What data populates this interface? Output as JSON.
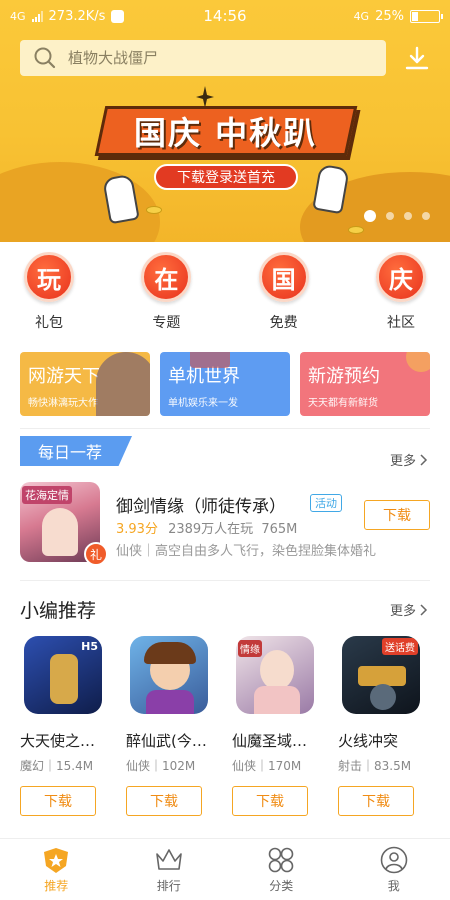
{
  "status": {
    "network": "4G",
    "speed": "273.2K/s",
    "time": "14:56",
    "network_right": "4G",
    "battery": "25%",
    "battery_level": 0.25
  },
  "search": {
    "placeholder": "植物大战僵尸"
  },
  "banner": {
    "title": "国庆 中秋趴",
    "subtitle": "下载登录送首充",
    "slides": 4,
    "active_slide": 0
  },
  "categories": [
    {
      "glyph": "玩",
      "label": "礼包"
    },
    {
      "glyph": "在",
      "label": "专题"
    },
    {
      "glyph": "国",
      "label": "免费"
    },
    {
      "glyph": "庆",
      "label": "社区"
    }
  ],
  "tiles": [
    {
      "title": "网游天下",
      "subtitle": "畅快淋漓玩大作",
      "color": "#f5b945"
    },
    {
      "title": "单机世界",
      "subtitle": "单机娱乐来一发",
      "color": "#5e9cf2"
    },
    {
      "title": "新游预约",
      "subtitle": "天天都有新鲜货",
      "color": "#f2757c"
    }
  ],
  "daily": {
    "tag": "每日一荐",
    "more": "更多",
    "game": {
      "icon_text": "花海定情",
      "title": "御剑情缘（师徒传承）",
      "badge": "活动",
      "score": "3.93分",
      "players": "2389万人在玩",
      "size": "765M",
      "desc": "仙侠｜高空自由多人飞行，染色捏脸集体婚礼",
      "button": "下载"
    }
  },
  "editor_picks": {
    "title": "小编推荐",
    "more": "更多",
    "items": [
      {
        "name": "大天使之…",
        "genre": "魔幻",
        "size": "15.4M",
        "button": "下载",
        "tag": "H5"
      },
      {
        "name": "醉仙武(今…",
        "genre": "仙侠",
        "size": "102M",
        "button": "下载",
        "tag": ""
      },
      {
        "name": "仙魔圣域…",
        "genre": "仙侠",
        "size": "170M",
        "button": "下载",
        "tag": "情缘"
      },
      {
        "name": "火线冲突",
        "genre": "射击",
        "size": "83.5M",
        "button": "下载",
        "tag": "送话费"
      }
    ]
  },
  "nav": [
    {
      "label": "推荐",
      "icon": "star-shield-icon",
      "active": true
    },
    {
      "label": "排行",
      "icon": "crown-icon",
      "active": false
    },
    {
      "label": "分类",
      "icon": "grid-circles-icon",
      "active": false
    },
    {
      "label": "我",
      "icon": "user-icon",
      "active": false
    }
  ],
  "colors": {
    "brand_yellow": "#f8c233",
    "accent_orange": "#f5a623",
    "badge_blue": "#41a8e6"
  }
}
